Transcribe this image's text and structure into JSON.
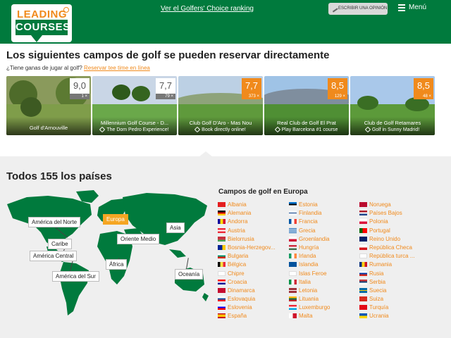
{
  "header": {
    "logo_line1": "LEADING",
    "logo_line2": "COURSES",
    "ranking_link": "Ver el Golfers' Choice ranking",
    "review_button": "ESCRIBIR UNA OPINIÓN",
    "menu_label": "Menú",
    "brand_green": "#007a3d",
    "accent_orange": "#f08a1c"
  },
  "bookable": {
    "title": "Los siguientes campos de golf se pueden reservar directamente",
    "question": "¿Tiene ganas de jugar al golf?",
    "link": "Reservar tee time en línea",
    "cards": [
      {
        "name": "Golf d'Arnouville",
        "tagline": "",
        "score": "9,0",
        "count": "1 ×",
        "score_style": "white"
      },
      {
        "name": "Millennium Golf Course - D...",
        "tagline": "The Dom Pedro Experience!",
        "score": "7,7",
        "count": "79 ×",
        "score_style": "white"
      },
      {
        "name": "Club Golf D'Aro - Mas Nou",
        "tagline": "Book directly online!",
        "score": "7,7",
        "count": "373 ×",
        "score_style": "orange"
      },
      {
        "name": "Real Club de Golf El Prat",
        "tagline": "Play Barcelona #1 course",
        "score": "8,5",
        "count": "129 ×",
        "score_style": "orange"
      },
      {
        "name": "Club de Golf Retamares",
        "tagline": "Golf in Sunny Madrid!",
        "score": "8,5",
        "count": "48 ×",
        "score_style": "orange"
      }
    ]
  },
  "countries_section": {
    "title": "Todos 155 los países",
    "map_labels": [
      "América del Norte",
      "Europa",
      "Asia",
      "Caribe",
      "Oriente Medio",
      "América Central",
      "África",
      "América del Sur",
      "Oceanía"
    ],
    "active_region": "Europa",
    "europe_title": "Campos de golf en Europa",
    "columns": [
      [
        "Albania",
        "Alemania",
        "Andorra",
        "Austria",
        "Bielorrusia",
        "Bosnia-Herzegov...",
        "Bulgaria",
        "Bélgica",
        "Chipre",
        "Croacia",
        "Dinamarca",
        "Eslovaquia",
        "Eslovenia",
        "España"
      ],
      [
        "Estonia",
        "Finlandia",
        "Francia",
        "Grecia",
        "Groenlandia",
        "Hungría",
        "Irlanda",
        "Islandia",
        "Islas Feroe",
        "Italia",
        "Letonia",
        "Lituania",
        "Luxemburgo",
        "Malta"
      ],
      [
        "Noruega",
        "Países Bajos",
        "Polonia",
        "Portugal",
        "Reino Unido",
        "República Checa",
        "República turca ...",
        "Rumania",
        "Rusia",
        "Serbia",
        "Suecia",
        "Suiza",
        "Turquía",
        "Ucrania"
      ]
    ]
  }
}
